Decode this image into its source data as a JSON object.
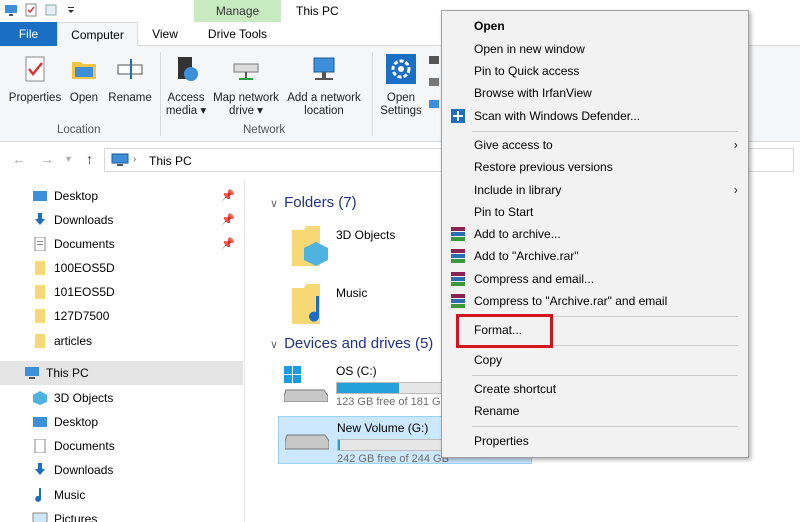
{
  "window": {
    "title": "This PC",
    "manage_tab": "Manage"
  },
  "tabs": {
    "file": "File",
    "computer": "Computer",
    "view": "View",
    "drive_tools": "Drive Tools"
  },
  "ribbon": {
    "properties": "Properties",
    "open": "Open",
    "rename": "Rename",
    "location_group": "Location",
    "access_media": "Access",
    "access_media2": "media ▾",
    "map_drive": "Map network",
    "map_drive2": "drive ▾",
    "add_location": "Add a network",
    "add_location2": "location",
    "network_group": "Network",
    "open_settings": "Open",
    "open_settings2": "Settings"
  },
  "address": {
    "path": "This PC"
  },
  "navpane": {
    "quick": [
      {
        "label": "Desktop",
        "pinned": true
      },
      {
        "label": "Downloads",
        "pinned": true
      },
      {
        "label": "Documents",
        "pinned": true
      },
      {
        "label": "100EOS5D"
      },
      {
        "label": "101EOS5D"
      },
      {
        "label": "127D7500"
      },
      {
        "label": "articles"
      }
    ],
    "this_pc": "This PC",
    "pc_items": [
      "3D Objects",
      "Desktop",
      "Documents",
      "Downloads",
      "Music",
      "Pictures"
    ]
  },
  "content": {
    "folders_header": "Folders (7)",
    "folders": [
      "3D Objects",
      "Music"
    ],
    "drives_header": "Devices and drives (5)",
    "drives": [
      {
        "name": "OS (C:)",
        "free": "123 GB free of 181 GB",
        "used_fraction": 0.32
      },
      {
        "name": "New Volume (G:)",
        "free": "242 GB free of 244 GB",
        "used_fraction": 0.01
      }
    ]
  },
  "context_menu": {
    "open": "Open",
    "open_new_window": "Open in new window",
    "pin_quick": "Pin to Quick access",
    "browse_irfan": "Browse with IrfanView",
    "scan_defender": "Scan with Windows Defender...",
    "give_access": "Give access to",
    "restore": "Restore previous versions",
    "include_library": "Include in library",
    "pin_start": "Pin to Start",
    "add_archive": "Add to archive...",
    "add_archive_rar": "Add to \"Archive.rar\"",
    "compress_email": "Compress and email...",
    "compress_rar_email": "Compress to \"Archive.rar\" and email",
    "format": "Format...",
    "copy": "Copy",
    "create_shortcut": "Create shortcut",
    "rename": "Rename",
    "properties": "Properties"
  },
  "colors": {
    "accent": "#1a6fc4",
    "highlight": "#d3151f",
    "manage": "#c8eac0",
    "drive_fill": "#26a0da"
  }
}
